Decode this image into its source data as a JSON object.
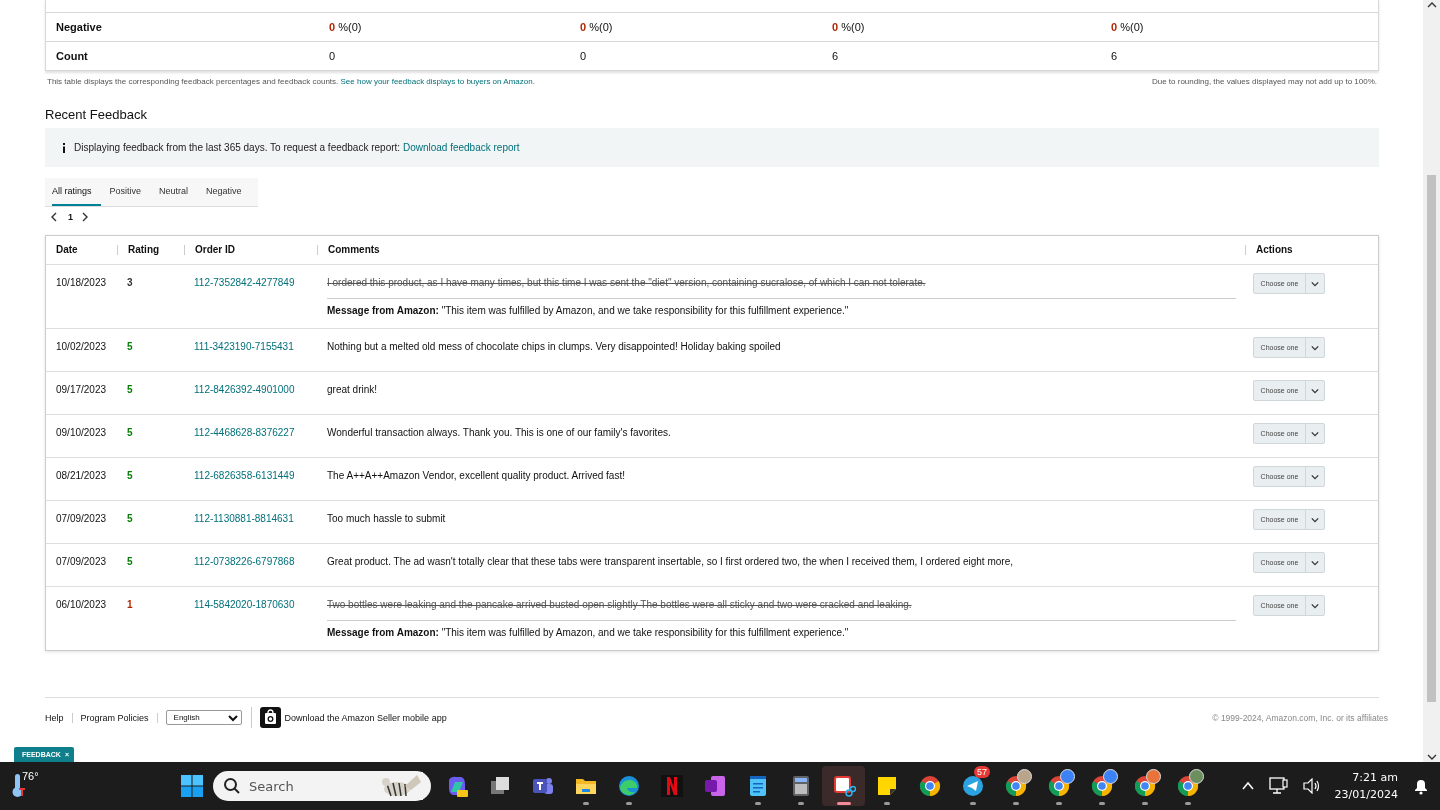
{
  "summary_table": {
    "rows": [
      {
        "label": "Negative",
        "kind": "percent",
        "cells": [
          {
            "value": "0",
            "detail": "%(0)"
          },
          {
            "value": "0",
            "detail": "%(0)"
          },
          {
            "value": "0",
            "detail": "%(0)"
          },
          {
            "value": "0",
            "detail": "%(0)"
          }
        ]
      },
      {
        "label": "Count",
        "kind": "count",
        "cells": [
          {
            "value": "0"
          },
          {
            "value": "0"
          },
          {
            "value": "6"
          },
          {
            "value": "6"
          }
        ]
      }
    ],
    "note": "This table displays the corresponding feedback percentages and feedback counts.",
    "note_link": "See how your feedback displays to buyers on Amazon.",
    "rounding_note": "Due to rounding, the values displayed may not add up to 100%."
  },
  "recent_feedback": {
    "title": "Recent Feedback",
    "info": "Displaying feedback from the last 365 days. To request a feedback report:",
    "info_link": "Download feedback report",
    "tabs": [
      {
        "label": "All ratings",
        "selected": true
      },
      {
        "label": "Positive",
        "selected": false
      },
      {
        "label": "Neutral",
        "selected": false
      },
      {
        "label": "Negative",
        "selected": false
      }
    ],
    "page": "1",
    "columns": [
      "Date",
      "Rating",
      "Order ID",
      "Comments",
      "Actions"
    ],
    "rows": [
      {
        "date": "10/18/2023",
        "rating": "3",
        "color": "#333333",
        "order_id": "112-7352842-4277849",
        "comment": "I ordered this product, as I have many times, but this time I was sent the \"diet\" version, containing sucralose, of which I can not tolerate.",
        "struck": true,
        "message": "**Message from Amazon:** \"This item was fulfilled by Amazon, and we take responsibility for this fulfillment experience.\"",
        "action": "Choose one"
      },
      {
        "date": "10/02/2023",
        "rating": "5",
        "color": "#067d06",
        "order_id": "111-3423190-7155431",
        "comment": "Nothing but a melted old mess of chocolate chips in clumps. Very disappointed! Holiday baking spoiled",
        "struck": false,
        "action": "Choose one"
      },
      {
        "date": "09/17/2023",
        "rating": "5",
        "color": "#067d06",
        "order_id": "112-8426392-4901000",
        "comment": "great drink!",
        "struck": false,
        "action": "Choose one"
      },
      {
        "date": "09/10/2023",
        "rating": "5",
        "color": "#067d06",
        "order_id": "112-4468628-8376227",
        "comment": "Wonderful transaction always. Thank you. This is one of our family's favorites.",
        "struck": false,
        "action": "Choose one"
      },
      {
        "date": "08/21/2023",
        "rating": "5",
        "color": "#067d06",
        "order_id": "112-6826358-6131449",
        "comment": "The A++A++Amazon Vendor, excellent quality product. Arrived fast!",
        "struck": false,
        "action": "Choose one"
      },
      {
        "date": "07/09/2023",
        "rating": "5",
        "color": "#067d06",
        "order_id": "112-1130881-8814631",
        "comment": "Too much hassle to submit",
        "struck": false,
        "action": "Choose one"
      },
      {
        "date": "07/09/2023",
        "rating": "5",
        "color": "#067d06",
        "order_id": "112-0738226-6797868",
        "comment": "Great product. The ad wasn't totally clear that these tabs were transparent insertable, so I first ordered two, the when I received them, I ordered eight more,",
        "struck": false,
        "action": "Choose one"
      },
      {
        "date": "06/10/2023",
        "rating": "1",
        "color": "#b12704",
        "order_id": "114-5842020-1870630",
        "comment": "Two bottles were leaking and the pancake arrived busted open slightly The bottles were all sticky and two were cracked and leaking.",
        "struck": true,
        "message": "**Message from Amazon:** \"This item was fulfilled by Amazon, and we take responsibility for this fulfillment experience.\"",
        "action": "Choose one"
      }
    ]
  },
  "footer": {
    "links": [
      "Help",
      "Program Policies"
    ],
    "language": "English",
    "app_link": "Download the Amazon Seller mobile app",
    "copyright": "© 1999-2024, Amazon.com, Inc. or its affiliates"
  },
  "feedback_tab": {
    "label": "FEEDBACK",
    "close": "×"
  },
  "taskbar": {
    "weather": "76°",
    "search_placeholder": "Search",
    "apps": [
      {
        "kind": "copilot",
        "running": false,
        "active": false
      },
      {
        "kind": "taskview",
        "running": false,
        "active": false
      },
      {
        "kind": "teams",
        "running": false,
        "active": false
      },
      {
        "kind": "explorer",
        "running": true,
        "active": false
      },
      {
        "kind": "edge",
        "running": true,
        "active": false
      },
      {
        "kind": "netflix",
        "running": false,
        "active": false
      },
      {
        "kind": "onenote",
        "running": false,
        "active": false
      },
      {
        "kind": "notepad",
        "running": true,
        "active": false
      },
      {
        "kind": "calculator",
        "running": true,
        "active": false
      },
      {
        "kind": "snip",
        "running": true,
        "active": true
      },
      {
        "kind": "sticky",
        "running": true,
        "active": false
      },
      {
        "kind": "chrome",
        "running": false,
        "active": false
      },
      {
        "kind": "telegram",
        "running": true,
        "active": false,
        "badge": "57"
      },
      {
        "kind": "chrome",
        "running": true,
        "active": false,
        "color": "#b8a58a"
      },
      {
        "kind": "chrome",
        "running": true,
        "active": false,
        "color": "#3b82f6"
      },
      {
        "kind": "chrome",
        "running": true,
        "active": false,
        "color": "#3b82f6"
      },
      {
        "kind": "chrome",
        "running": true,
        "active": false,
        "color": "#e8743b"
      },
      {
        "kind": "chrome",
        "running": true,
        "active": false,
        "color": "#6b8f5e"
      }
    ],
    "time": "7:21 am",
    "date": "23/01/2024"
  }
}
